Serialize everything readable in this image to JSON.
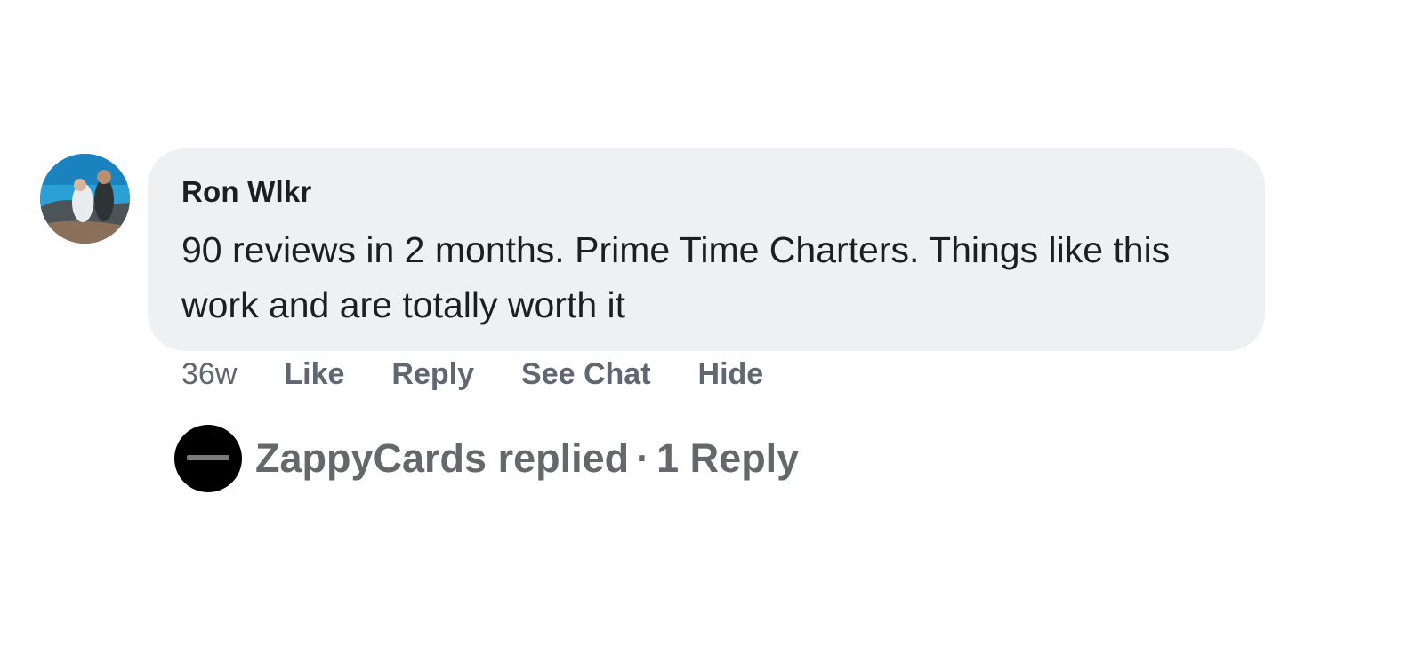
{
  "comment": {
    "author": "Ron Wlkr",
    "text": "90 reviews in 2 months. Prime Time Charters. Things like this work and are totally worth it",
    "timestamp": "36w",
    "actions": {
      "like": "Like",
      "reply": "Reply",
      "see_chat": "See Chat",
      "hide": "Hide"
    }
  },
  "reply_summary": {
    "replier": "ZappyCards",
    "replied_text": "replied",
    "separator": "·",
    "count_text": "1 Reply"
  },
  "colors": {
    "bubble_bg": "#eef0f2",
    "text_primary": "#1c1e21",
    "text_secondary": "#65676b"
  }
}
